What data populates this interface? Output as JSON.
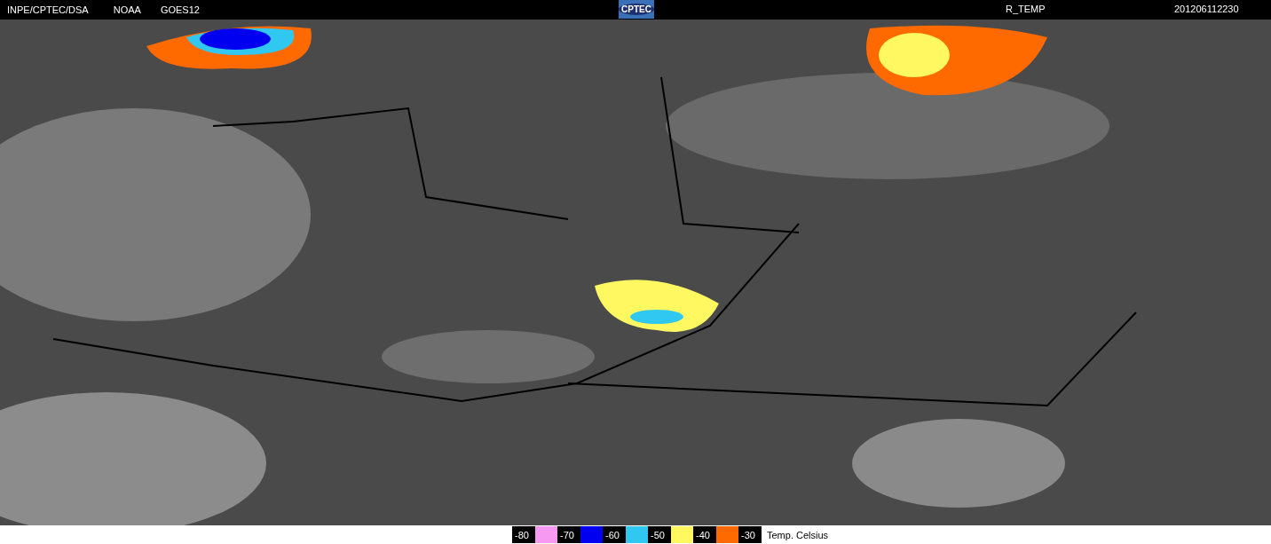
{
  "header": {
    "left": [
      "INPE/CPTEC/DSA",
      "NOAA",
      "GOES12"
    ],
    "logo": "CPTEC",
    "product": "R_TEMP",
    "timestamp": "201206112230"
  },
  "legend": {
    "entries": [
      {
        "kind": "label",
        "text": "-80"
      },
      {
        "kind": "swatch",
        "color": "#f59af0"
      },
      {
        "kind": "label",
        "text": "-70"
      },
      {
        "kind": "swatch",
        "color": "#0000f0"
      },
      {
        "kind": "label",
        "text": "-60"
      },
      {
        "kind": "swatch",
        "color": "#30c8f0"
      },
      {
        "kind": "label",
        "text": "-50"
      },
      {
        "kind": "swatch",
        "color": "#fff860"
      },
      {
        "kind": "label",
        "text": "-40"
      },
      {
        "kind": "swatch",
        "color": "#ff6a00"
      },
      {
        "kind": "label",
        "text": "-30"
      }
    ],
    "unit": "Temp. Celsius"
  }
}
